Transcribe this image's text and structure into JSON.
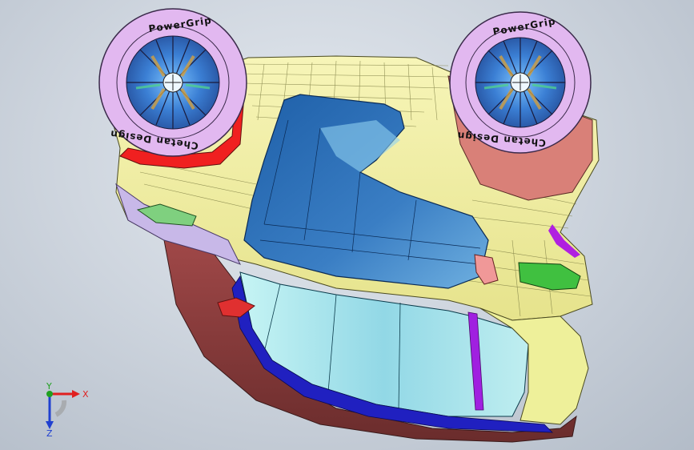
{
  "viewport": {
    "background_top": "#e4e9ef",
    "background_bottom": "#b3bcc8"
  },
  "model": {
    "tire_text_top": "PowerGrip",
    "tire_text_bottom": "Chetan Design",
    "colors": {
      "roof_cream": "#f2f0a0",
      "glass_blue": "#2f6fb5",
      "glass_light": "#a8e6ef",
      "tire_lilac": "#e2b8f0",
      "rim_blue": "#3b7fd4",
      "bumper_red": "#f02020",
      "salmon": "#d98078",
      "lower_maroon": "#8a3c3c",
      "skirt_blue": "#2020c0",
      "accent_purple": "#a020e0",
      "accent_green": "#40c040"
    }
  },
  "triad": {
    "x_label": "X",
    "y_label": "Y",
    "z_label": "Z",
    "x_color": "#e02020",
    "y_color": "#20a020",
    "z_color": "#2040d0"
  }
}
